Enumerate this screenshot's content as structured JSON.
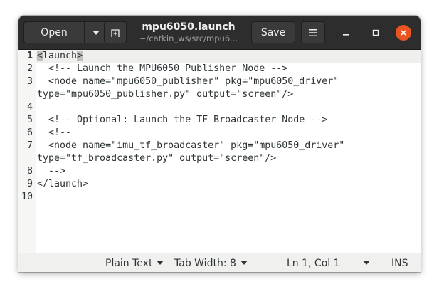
{
  "header": {
    "open_label": "Open",
    "title": "mpu6050.launch",
    "subtitle": "~/catkin_ws/src/mpu6...",
    "save_label": "Save"
  },
  "editor": {
    "line_numbers": [
      "1",
      "2",
      "3",
      "",
      "4",
      "5",
      "6",
      "7",
      "",
      "8",
      "9",
      "10"
    ],
    "lines": [
      {
        "text": "<launch>"
      },
      {
        "text": "  <!-- Launch the MPU6050 Publisher Node -->"
      },
      {
        "text": "  <node name=\"mpu6050_publisher\" pkg=\"mpu6050_driver\""
      },
      {
        "text": "type=\"mpu6050_publisher.py\" output=\"screen\"/>"
      },
      {
        "text": ""
      },
      {
        "text": "  <!-- Optional: Launch the TF Broadcaster Node -->"
      },
      {
        "text": "  <!--"
      },
      {
        "text": "  <node name=\"imu_tf_broadcaster\" pkg=\"mpu6050_driver\""
      },
      {
        "text": "type=\"tf_broadcaster.py\" output=\"screen\"/>"
      },
      {
        "text": "  -->"
      },
      {
        "text": "</launch>"
      },
      {
        "text": ""
      }
    ],
    "line1_open": "<",
    "line1_word": "launch",
    "line1_close": ">"
  },
  "status": {
    "language": "Plain Text",
    "tab_width": "Tab Width: 8",
    "position": "Ln 1, Col 1",
    "mode": "INS"
  },
  "colors": {
    "headerbar": "#2d2d2d",
    "close_button": "#e95420"
  }
}
